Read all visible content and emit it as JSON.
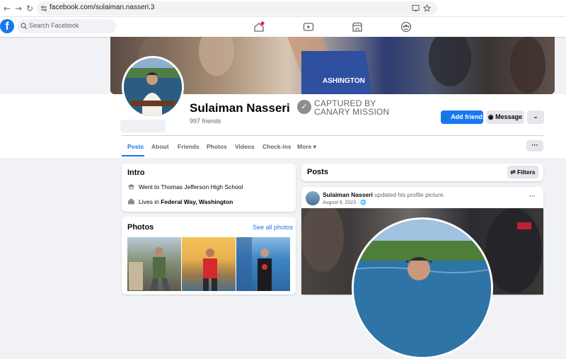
{
  "browser": {
    "url": "facebook.com/sulaiman.nasseri.3",
    "back_icon": "←",
    "forward_icon": "→",
    "reload_icon": "↻"
  },
  "header": {
    "logo_letter": "f",
    "search_placeholder": "Search Facebook"
  },
  "profile": {
    "name": "Sulaiman Nasseri",
    "friends": "997 friends",
    "overlay_line1": "CAPTURED BY",
    "overlay_line2": "CANARY MISSION",
    "add_friend": "Add friend",
    "message": "Message",
    "more_icon": "⌄"
  },
  "tabs": [
    {
      "label": "Posts"
    },
    {
      "label": "About"
    },
    {
      "label": "Friends"
    },
    {
      "label": "Photos"
    },
    {
      "label": "Videos"
    },
    {
      "label": "Check-ins"
    },
    {
      "label": "More ▾"
    }
  ],
  "tab_menu": "···",
  "intro": {
    "title": "Intro",
    "school_prefix": "Went to Thomas Jefferson High School",
    "lives_prefix": "Lives in ",
    "lives_place": "Federal Way, Washington"
  },
  "photos": {
    "title": "Photos",
    "see_all": "See all photos"
  },
  "posts": {
    "title": "Posts",
    "filters": "Filters",
    "author": "Sulaiman Nasseri",
    "action": " updated his profile picture.",
    "date": "August 9, 2023 · ",
    "menu": "···"
  },
  "colors": {
    "accent": "#1877f2",
    "bg": "#f0f2f5"
  }
}
